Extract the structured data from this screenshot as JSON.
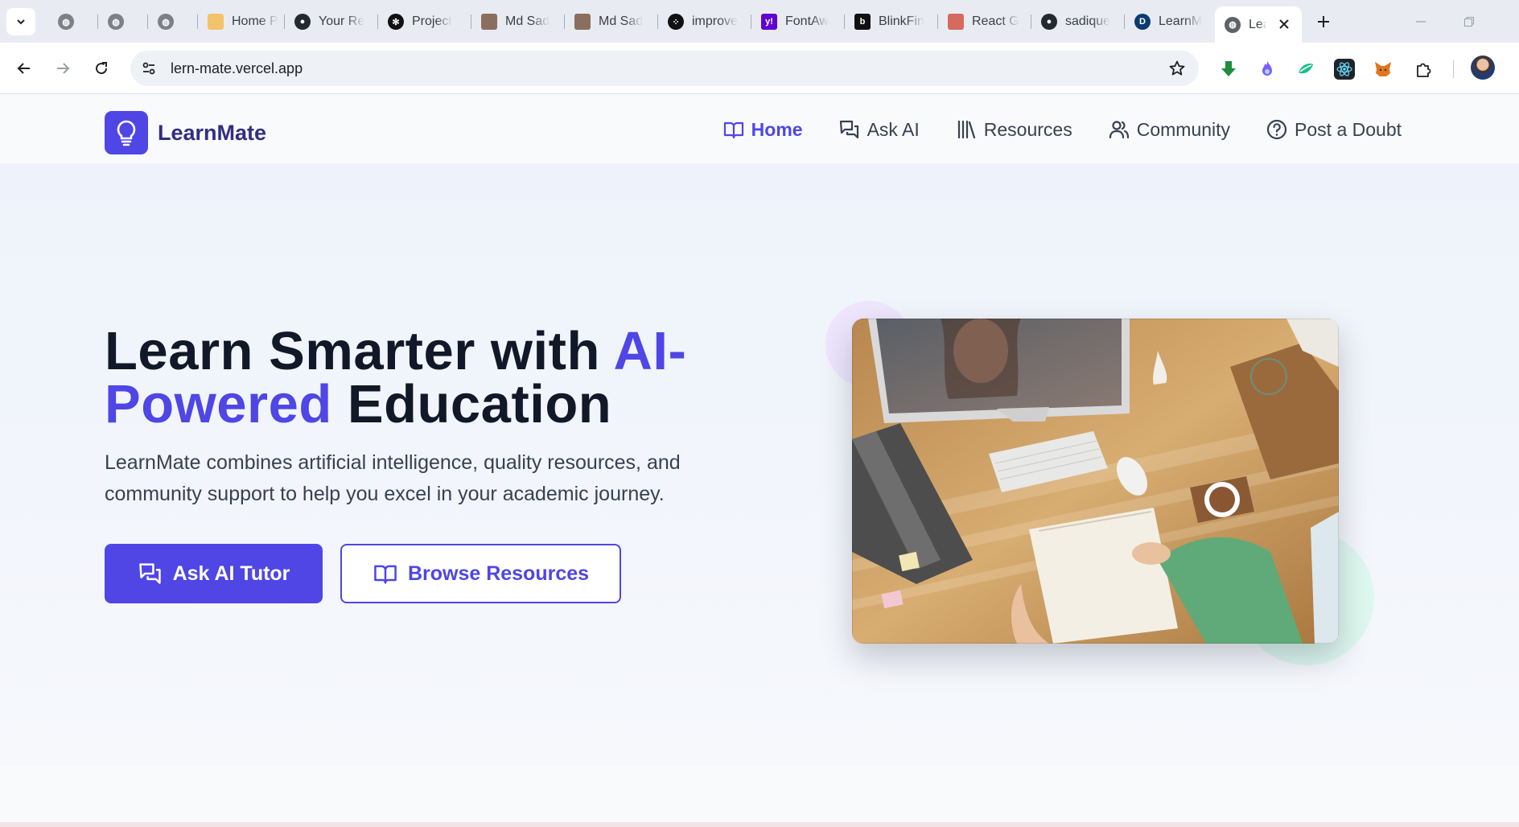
{
  "browser": {
    "tabs": [
      {
        "title": "",
        "favicon": "globe-icon"
      },
      {
        "title": "",
        "favicon": "globe-icon"
      },
      {
        "title": "",
        "favicon": "globe-icon"
      },
      {
        "title": "Home P",
        "favicon": "stack-icon"
      },
      {
        "title": "Your Re",
        "favicon": "github-icon"
      },
      {
        "title": "Project",
        "favicon": "openai-icon"
      },
      {
        "title": "Md Sad",
        "favicon": "profile-photo-icon"
      },
      {
        "title": "Md Sad",
        "favicon": "profile-photo-icon"
      },
      {
        "title": "improve",
        "favicon": "dots-icon"
      },
      {
        "title": "FontAw",
        "favicon": "yahoo-icon"
      },
      {
        "title": "BlinkFin",
        "favicon": "b-icon"
      },
      {
        "title": "React G",
        "favicon": "image-icon"
      },
      {
        "title": "sadique",
        "favicon": "github-icon"
      },
      {
        "title": "LearnM",
        "favicon": "d-icon"
      },
      {
        "title": "Lea",
        "favicon": "globe-icon",
        "active": true
      }
    ],
    "address_bar": {
      "url": "lern-mate.vercel.app"
    },
    "extensions": [
      "download-extension-icon",
      "flame-extension-icon",
      "leaf-extension-icon",
      "react-devtools-icon",
      "metamask-fox-icon",
      "puzzle-extensions-icon"
    ]
  },
  "site": {
    "brand": "LearnMate",
    "nav": [
      {
        "label": "Home",
        "icon": "book-open-icon",
        "active": true
      },
      {
        "label": "Ask AI",
        "icon": "chat-bubbles-icon"
      },
      {
        "label": "Resources",
        "icon": "library-icon"
      },
      {
        "label": "Community",
        "icon": "users-icon"
      },
      {
        "label": "Post a Doubt",
        "icon": "help-circle-icon"
      }
    ],
    "hero": {
      "title_part1": "Learn Smarter with ",
      "title_accent1": "AI-",
      "title_accent2": "Powered",
      "title_part2": " Education",
      "subtitle": "LearnMate combines artificial intelligence, quality resources, and community support to help you excel in your academic journey.",
      "primary_button": "Ask AI Tutor",
      "secondary_button": "Browse Resources"
    },
    "colors": {
      "accent": "#4f46e5",
      "brand_dark": "#312e81",
      "text": "#111827"
    }
  }
}
